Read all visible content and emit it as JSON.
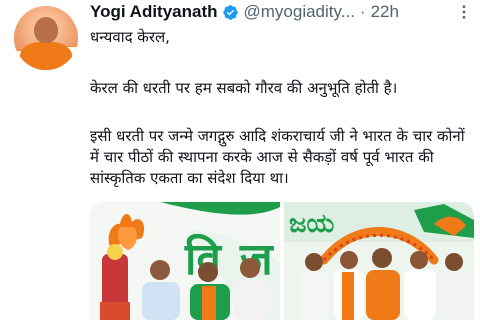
{
  "author": {
    "name": "Yogi Adityanath",
    "handle": "@myogiadity...",
    "separator": "·",
    "time": "22h"
  },
  "icons": {
    "verified": "verified-badge-icon",
    "more": "more-options-icon"
  },
  "colors": {
    "verified": "#1d9bf0",
    "saffron": "#f07a18",
    "green": "#1e9e4a"
  },
  "tweet": {
    "line1": "धन्यवाद केरल,",
    "line2": "केरल की धरती पर हम सबको गौरव की अनुभूति होती है।",
    "line3": "इसी धरती पर जन्मे जगद्गुरु आदि शंकराचार्य जी ने भारत के चार कोनों में चार पीठों की स्थापना करके आज से सैकड़ों वर्ष पूर्व भारत की सांस्कृतिक एकता का संदेश दिया था।"
  },
  "media": {
    "count": 2
  }
}
